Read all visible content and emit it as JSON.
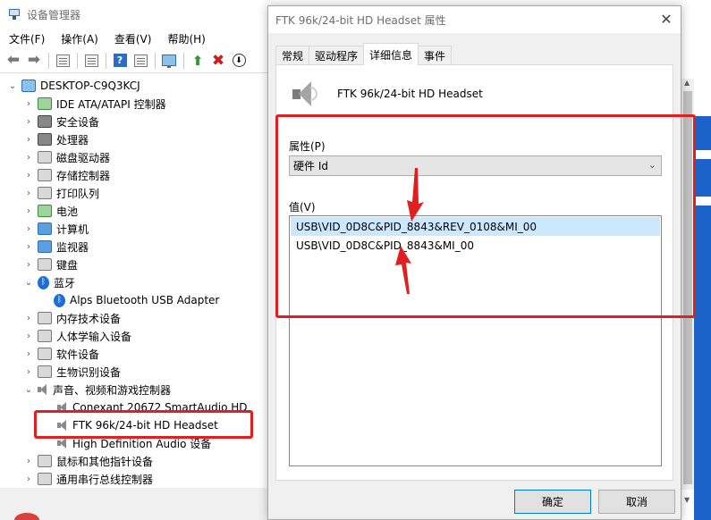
{
  "device_manager": {
    "title": "设备管理器",
    "menu": [
      "文件(F)",
      "操作(A)",
      "查看(V)",
      "帮助(H)"
    ],
    "tree": {
      "root": "DESKTOP-C9Q3KCJ",
      "items": [
        {
          "label": "IDE ATA/ATAPI 控制器",
          "icon": "ide-icon"
        },
        {
          "label": "安全设备",
          "icon": "security-icon"
        },
        {
          "label": "处理器",
          "icon": "processor-icon"
        },
        {
          "label": "磁盘驱动器",
          "icon": "disk-icon"
        },
        {
          "label": "存储控制器",
          "icon": "storage-icon"
        },
        {
          "label": "打印队列",
          "icon": "printer-icon"
        },
        {
          "label": "电池",
          "icon": "battery-icon"
        },
        {
          "label": "计算机",
          "icon": "computer-icon"
        },
        {
          "label": "监视器",
          "icon": "monitor-icon"
        },
        {
          "label": "键盘",
          "icon": "keyboard-icon"
        },
        {
          "label": "蓝牙",
          "icon": "bluetooth-icon"
        },
        {
          "label": "Alps Bluetooth USB Adapter",
          "icon": "bluetooth-icon"
        },
        {
          "label": "内存技术设备",
          "icon": "memory-icon"
        },
        {
          "label": "人体学输入设备",
          "icon": "hid-icon"
        },
        {
          "label": "软件设备",
          "icon": "software-icon"
        },
        {
          "label": "生物识别设备",
          "icon": "fingerprint-icon"
        },
        {
          "label": "声音、视频和游戏控制器",
          "icon": "speaker-icon"
        },
        {
          "label": "Conexant 20672 SmartAudio HD",
          "icon": "speaker-icon"
        },
        {
          "label": "FTK 96k/24-bit HD Headset",
          "icon": "speaker-icon"
        },
        {
          "label": "High Definition Audio 设备",
          "icon": "speaker-icon"
        },
        {
          "label": "鼠标和其他指针设备",
          "icon": "mouse-icon"
        },
        {
          "label": "通用串行总线控制器",
          "icon": "usb-icon"
        }
      ]
    }
  },
  "dialog": {
    "title": "FTK 96k/24-bit HD Headset 属性",
    "tabs": [
      "常规",
      "驱动程序",
      "详细信息",
      "事件"
    ],
    "active_tab": "详细信息",
    "device_name": "FTK 96k/24-bit HD Headset",
    "property_label": "属性(P)",
    "property_value": "硬件 Id",
    "value_label": "值(V)",
    "values": [
      "USB\\VID_0D8C&PID_8843&REV_0108&MI_00",
      "USB\\VID_0D8C&PID_8843&MI_00"
    ],
    "ok_label": "确定",
    "cancel_label": "取消",
    "close_glyph": "✕"
  },
  "colors": {
    "annotation_red": "#e02020",
    "selection_blue": "#cce8ff",
    "windows_blue": "#1b63c9"
  }
}
